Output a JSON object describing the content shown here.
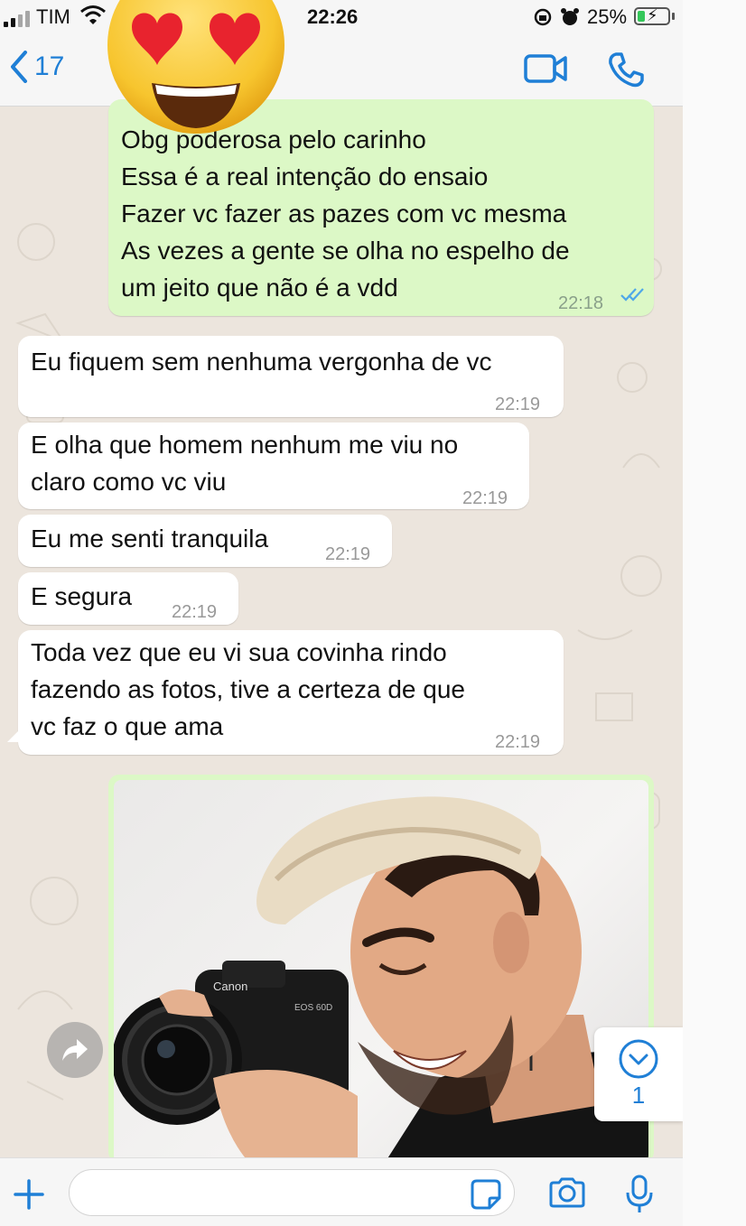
{
  "status_bar": {
    "carrier": "TIM",
    "time": "22:26",
    "battery_percent": "25%",
    "battery_level": 0.25,
    "icons": [
      "signal-icon",
      "wifi-icon",
      "orientation-lock-icon",
      "alarm-icon",
      "battery-charging-icon"
    ]
  },
  "header": {
    "back_count": "17",
    "icons": [
      "chevron-left-icon",
      "video-call-icon",
      "phone-icon"
    ]
  },
  "overlay_emoji": "heart-eyes-emoji",
  "messages": [
    {
      "direction": "outgoing",
      "lines": [
        "Obg poderosa pelo carinho",
        "Essa é a real intenção do ensaio",
        "Fazer vc fazer as pazes com vc mesma",
        "As vezes a gente se olha no espelho de",
        "um jeito que não é a vdd"
      ],
      "text": "Obg poderosa pelo carinho\nEssa é a real intenção do ensaio\nFazer vc fazer as pazes com vc mesma\nAs vezes a gente se olha no espelho de\num jeito que não é a vdd",
      "time": "22:18",
      "read": true
    },
    {
      "direction": "incoming",
      "text": "Eu fiquem sem nenhuma vergonha de vc",
      "time": "22:19"
    },
    {
      "direction": "incoming",
      "text": "E olha que homem nenhum me viu no\nclaro como vc viu",
      "time": "22:19"
    },
    {
      "direction": "incoming",
      "text": "Eu me senti tranquila",
      "time": "22:19"
    },
    {
      "direction": "incoming",
      "text": "E segura",
      "time": "22:19"
    },
    {
      "direction": "incoming",
      "text": "Toda vez que eu vi sua covinha rindo\nfazendo as fotos, tive a certeza de que\nvc faz o que ama",
      "time": "22:19"
    }
  ],
  "image_message": {
    "direction": "outgoing",
    "camera_brand": "Canon",
    "camera_model": "EOS 60D"
  },
  "scroll_down": {
    "unread_count": "1"
  },
  "input_bar": {
    "placeholder": "",
    "value": "",
    "icons": [
      "plus-icon",
      "sticker-icon",
      "camera-icon",
      "microphone-icon"
    ]
  },
  "colors": {
    "chat_background": "#ece5dd",
    "outgoing_bubble": "#dcf8c6",
    "incoming_bubble": "#ffffff",
    "accent": "#1f7fd6",
    "read_ticks": "#4fa8e8"
  }
}
